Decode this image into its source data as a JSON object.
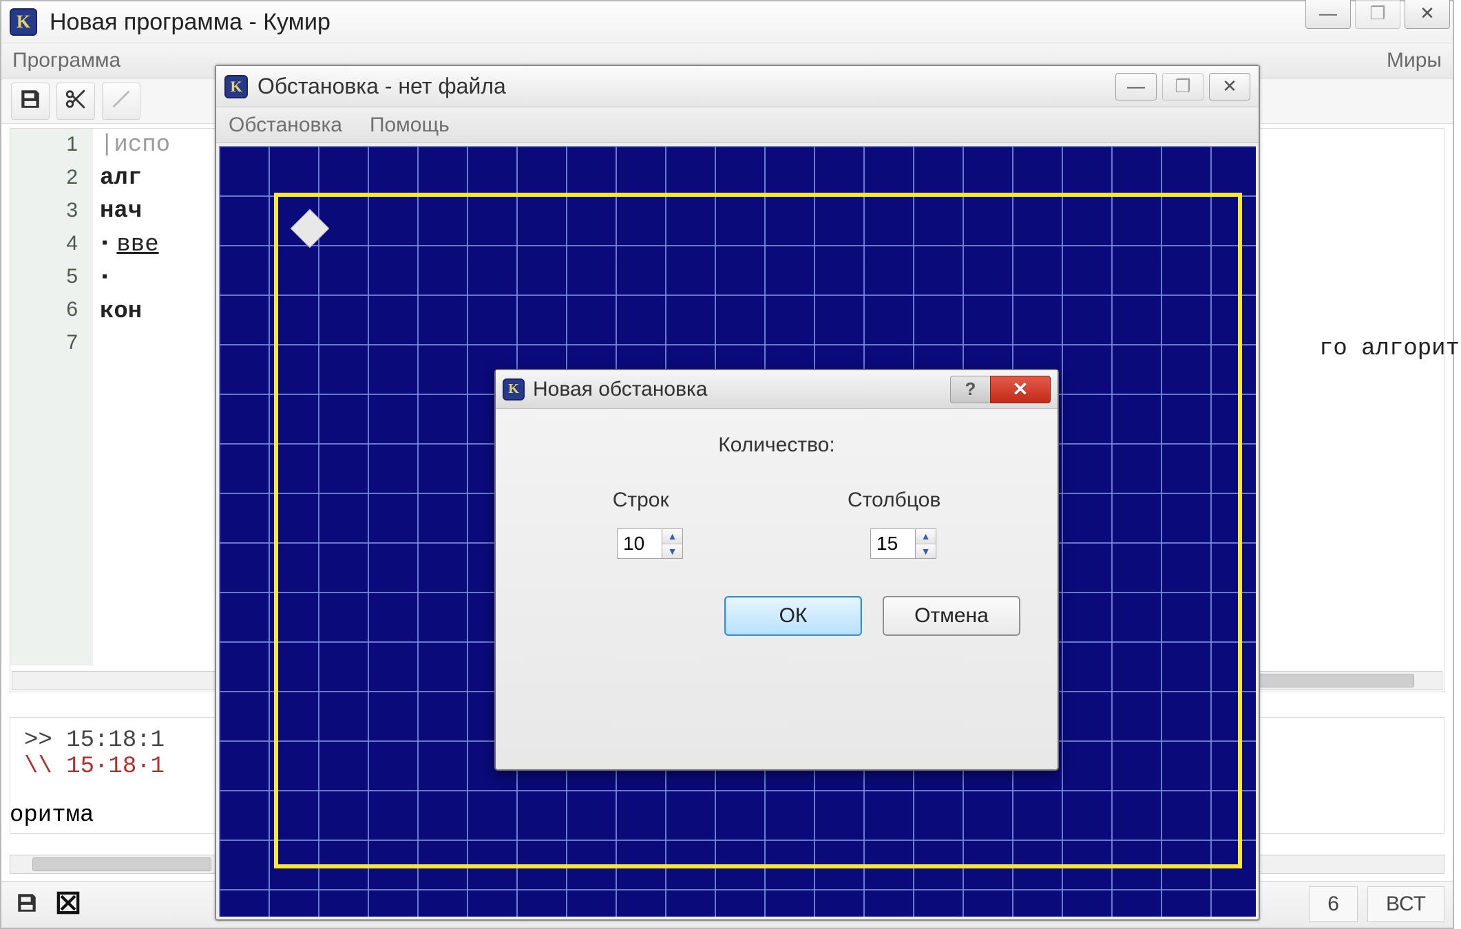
{
  "main": {
    "title": "Новая программа - Кумир",
    "menu": {
      "program": "Программа",
      "worlds": "Миры"
    },
    "editor": {
      "lines": [
        "1",
        "2",
        "3",
        "4",
        "5",
        "6",
        "7"
      ],
      "l1": "|испо",
      "l2": "алг",
      "l3": "нач",
      "l4": "вве",
      "l6": "кон",
      "overflow_right": "го алгорит"
    },
    "console": {
      "line1": ">> 15:18:1",
      "line2": "\\\\ 15·18·1",
      "right_cut": "оритма"
    },
    "status": {
      "num": "6",
      "mode": "ВСТ"
    }
  },
  "env": {
    "title": "Обстановка - нет файла",
    "menu": {
      "env": "Обстановка",
      "help": "Помощь"
    }
  },
  "dialog": {
    "title": "Новая обстановка",
    "heading": "Количество:",
    "rows_label": "Строк",
    "cols_label": "Столбцов",
    "rows_value": "10",
    "cols_value": "15",
    "ok": "ОК",
    "cancel": "Отмена",
    "help_glyph": "?",
    "close_glyph": "✕"
  },
  "glyphs": {
    "min": "—",
    "max": "❐",
    "close": "✕"
  }
}
